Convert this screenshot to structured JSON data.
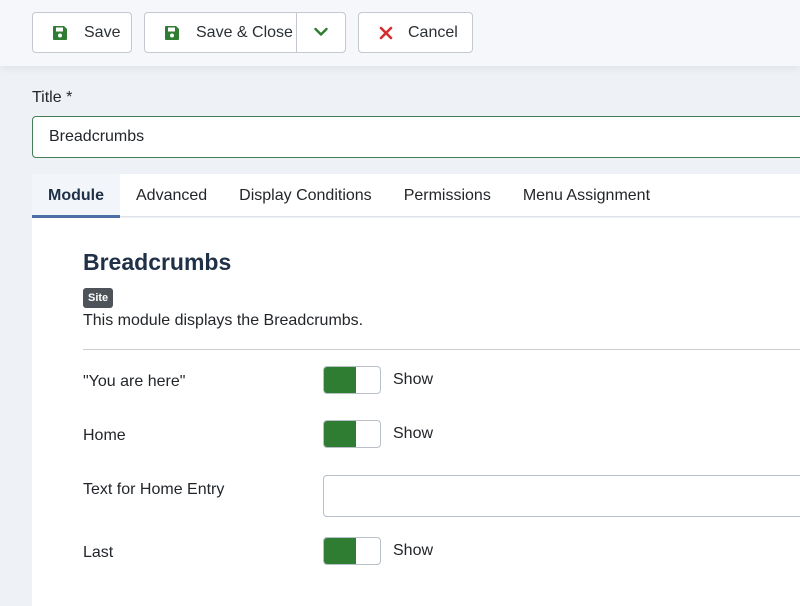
{
  "toolbar": {
    "save_label": "Save",
    "save_close_label": "Save & Close",
    "cancel_label": "Cancel",
    "save_icon_color": "#2e7d32",
    "cancel_icon_color": "#d32f2f"
  },
  "title_field": {
    "label": "Title *",
    "value": "Breadcrumbs"
  },
  "tabs": [
    {
      "label": "Module",
      "active": true
    },
    {
      "label": "Advanced",
      "active": false
    },
    {
      "label": "Display Conditions",
      "active": false
    },
    {
      "label": "Permissions",
      "active": false
    },
    {
      "label": "Menu Assignment",
      "active": false
    }
  ],
  "module": {
    "heading": "Breadcrumbs",
    "badge": "Site",
    "description": "This module displays the Breadcrumbs."
  },
  "fields": {
    "you_are_here": {
      "label": "\"You are here\"",
      "state": "Show"
    },
    "home": {
      "label": "Home",
      "state": "Show"
    },
    "home_text": {
      "label": "Text for Home Entry",
      "value": ""
    },
    "last": {
      "label": "Last",
      "state": "Show"
    }
  },
  "colors": {
    "switch_on": "#2e7d32",
    "tab_active_underline": "#4c6fa8"
  }
}
